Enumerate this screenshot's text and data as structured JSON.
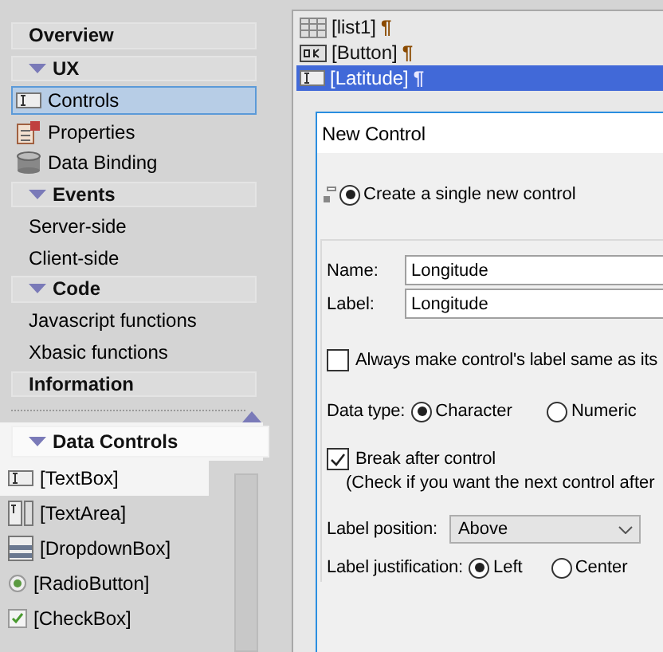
{
  "sidebar": {
    "sections": [
      {
        "title": "Overview"
      },
      {
        "title": "UX",
        "items": [
          {
            "label": "Controls",
            "kind": "textbox",
            "selected": true
          },
          {
            "label": "Properties",
            "kind": "properties",
            "selected": false
          },
          {
            "label": "Data Binding",
            "kind": "database",
            "selected": false
          }
        ]
      },
      {
        "title": "Events",
        "items": [
          {
            "label": "Server-side",
            "selected": false
          },
          {
            "label": "Client-side",
            "selected": false
          }
        ]
      },
      {
        "title": "Code",
        "items": [
          {
            "label": "Javascript functions",
            "selected": false
          },
          {
            "label": "Xbasic functions",
            "selected": false
          }
        ]
      },
      {
        "title": "Information"
      }
    ]
  },
  "toolbox": {
    "title": "Data Controls",
    "items": [
      {
        "label": "[TextBox]",
        "kind": "textbox",
        "selected": true
      },
      {
        "label": "[TextArea]",
        "kind": "textarea",
        "selected": false
      },
      {
        "label": "[DropdownBox]",
        "kind": "dropdown",
        "selected": false
      },
      {
        "label": "[RadioButton]",
        "kind": "radio",
        "selected": false
      },
      {
        "label": "[CheckBox]",
        "kind": "checkbox",
        "selected": false
      }
    ]
  },
  "canvas": {
    "items": [
      {
        "label": "[list1]",
        "mark": "¶",
        "kind": "list",
        "selected": false
      },
      {
        "label": "[Button]",
        "mark": "¶",
        "kind": "button",
        "selected": false
      },
      {
        "label": "[Latitude]",
        "mark": "¶",
        "kind": "textbox",
        "selected": true
      }
    ]
  },
  "dialog": {
    "title": "New Control",
    "mode": {
      "label": "Create a single new control",
      "selected": true
    },
    "name": {
      "label": "Name:",
      "value": "Longitude"
    },
    "label_field": {
      "label": "Label:",
      "value": "Longitude"
    },
    "same_label": {
      "label": "Always make control's label same as its",
      "checked": false
    },
    "data_type": {
      "label": "Data type:",
      "options": [
        {
          "label": "Character",
          "selected": true
        },
        {
          "label": "Numeric",
          "selected": false
        }
      ]
    },
    "break_after": {
      "label": "Break after control",
      "checked": true,
      "note": "(Check if you want the next control after"
    },
    "label_position": {
      "label": "Label position:",
      "value": "Above"
    },
    "label_justification": {
      "label": "Label justification:",
      "options": [
        {
          "label": "Left",
          "selected": true
        },
        {
          "label": "Center",
          "selected": false
        }
      ]
    }
  }
}
